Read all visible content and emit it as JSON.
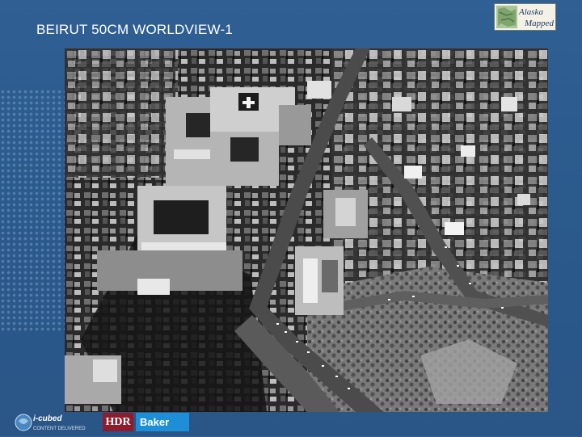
{
  "slide": {
    "title": "BEIRUT 50CM WORLDVIEW-1"
  },
  "image": {
    "icon": "satellite-aerial-photo"
  },
  "logos": {
    "alaska_line1": "Alaska",
    "alaska_line2": "Mapped",
    "icubed_name": "i-cubed",
    "icubed_tagline": "CONTENT DELIVERED",
    "hdr": "HDR",
    "baker": "Baker"
  },
  "colors": {
    "background": "#2c5a8c",
    "hdr": "#8e1c2c",
    "baker": "#1e8fd6"
  }
}
